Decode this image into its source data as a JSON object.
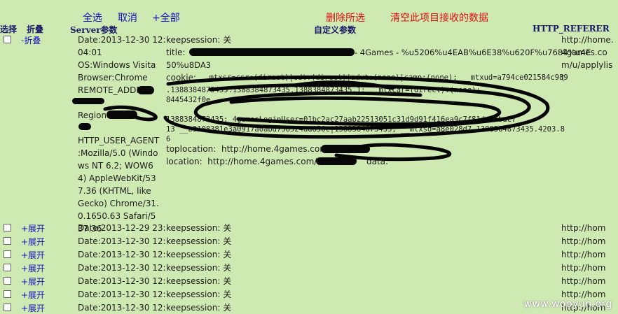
{
  "toolbar": {
    "select_all": "全选",
    "cancel": "取消",
    "expand_all": "+全部",
    "delete_selected": "删除所选",
    "clear_project_data": "清空此项目接收的数据"
  },
  "columns": {
    "select": "选择",
    "fold": "折叠",
    "server_params": "Server参数",
    "custom_params": "自定义参数",
    "http_referer": "HTTP_REFERER"
  },
  "expanded_row": {
    "fold_label": "-折叠",
    "server": {
      "date": "Date:2013-12-30 12:",
      "date_time": "04:01",
      "os": "OS:Windows Visita",
      "browser": "Browser:Chrome",
      "remote_addr": "REMOTE_ADDR:",
      "region": "Region:",
      "user_agent_label": "HTTP_USER_AGENT",
      "user_agent": ":Mozilla/5.0 (Windows NT 6.2; WOW64) AppleWebKit/537.36 (KHTML, like Gecko) Chrome/31.0.1650.63 Safari/537.36"
    },
    "custom": {
      "keepsession_label": "keepsession:",
      "keepsession_value": "关",
      "title_label": "title:",
      "title_value_tail": "- 4Games - %u5206%u4EAB%u6E38%u620F%u7684%u4E",
      "title_value_line2": "50%u8DA3",
      "cookie_label": "cookie:",
      "cookie_line1": "__mtxsr=csr:(direct)|cdt:(direct)|advt:(none)|camp:(none); __mtxud=a794ce021584c989",
      "cookie_line2": ".1388384873435.1388384873435.1388384873435.1; __mtxcar=(direct):(none);",
      "cookie_line3": "8445432f0e",
      "cookie_line4": "1388384873435; 4gamesLoginUser=01bc2ac27aab22513051c31d9d91f416ea9c7f81defbbac7",
      "cookie_line5": "13 __b9108381e3a0917a0abd758524ad856c|1388384873435; __mtxsd=a8e028d7.1388384873435.4203.8",
      "cookie_line6": "6",
      "toplocation_label": "toplocation:",
      "toplocation_value": "http://home.4games.com/u",
      "location_label": "location:",
      "location_value": "http://home.4games.com/u/",
      "data_label": "data:"
    },
    "referer": "http://home.4games.com/u/applylist"
  },
  "collapsed_rows": [
    {
      "fold": "+展开",
      "date": "Date:2013-12-29 23:",
      "keepsession_label": "keepsession:",
      "keepsession_value": "关",
      "referer": "http://hom"
    },
    {
      "fold": "+展开",
      "date": "Date:2013-12-30 12:",
      "keepsession_label": "keepsession:",
      "keepsession_value": "关",
      "referer": "http://hom"
    },
    {
      "fold": "+展开",
      "date": "Date:2013-12-30 12:",
      "keepsession_label": "keepsession:",
      "keepsession_value": "关",
      "referer": "http://hom"
    },
    {
      "fold": "+展开",
      "date": "Date:2013-12-30 12:",
      "keepsession_label": "keepsession:",
      "keepsession_value": "关",
      "referer": "http://hom"
    },
    {
      "fold": "+展开",
      "date": "Date:2013-12-30 12:",
      "keepsession_label": "keepsession:",
      "keepsession_value": "关",
      "referer": "http://hom"
    },
    {
      "fold": "+展开",
      "date": "Date:2013-12-30 12:",
      "keepsession_label": "keepsession:",
      "keepsession_value": "关",
      "referer": "http://hom"
    },
    {
      "fold": "+展开",
      "date": "Date:2013-12-30 12:",
      "keepsession_label": "keepsession:",
      "keepsession_value": "关",
      "referer": "http://hom"
    }
  ],
  "watermark": "www.wooyun.org"
}
